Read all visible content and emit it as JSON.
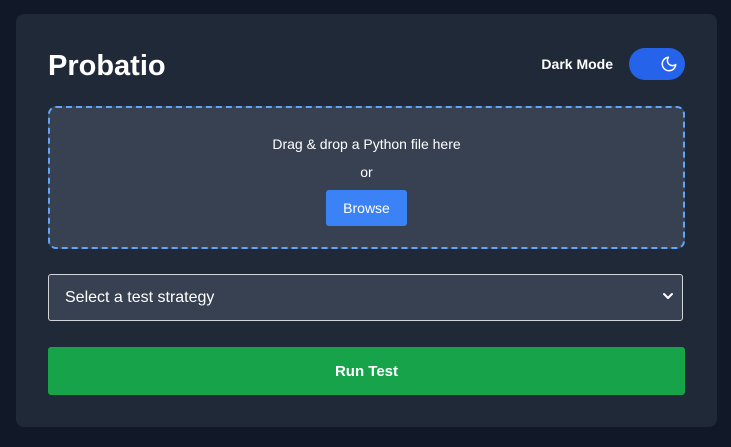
{
  "app": {
    "title": "Probatio"
  },
  "theme_toggle": {
    "label": "Dark Mode",
    "state": "on",
    "icon": "moon-icon",
    "color": "#2563eb"
  },
  "upload": {
    "prompt": "Drag & drop a Python file here",
    "or_text": "or",
    "browse_label": "Browse",
    "border_color": "#60a5fa"
  },
  "strategy": {
    "placeholder": "Select a test strategy",
    "icon": "chevron-down-icon"
  },
  "run": {
    "label": "Run Test",
    "color": "#16a34a"
  }
}
